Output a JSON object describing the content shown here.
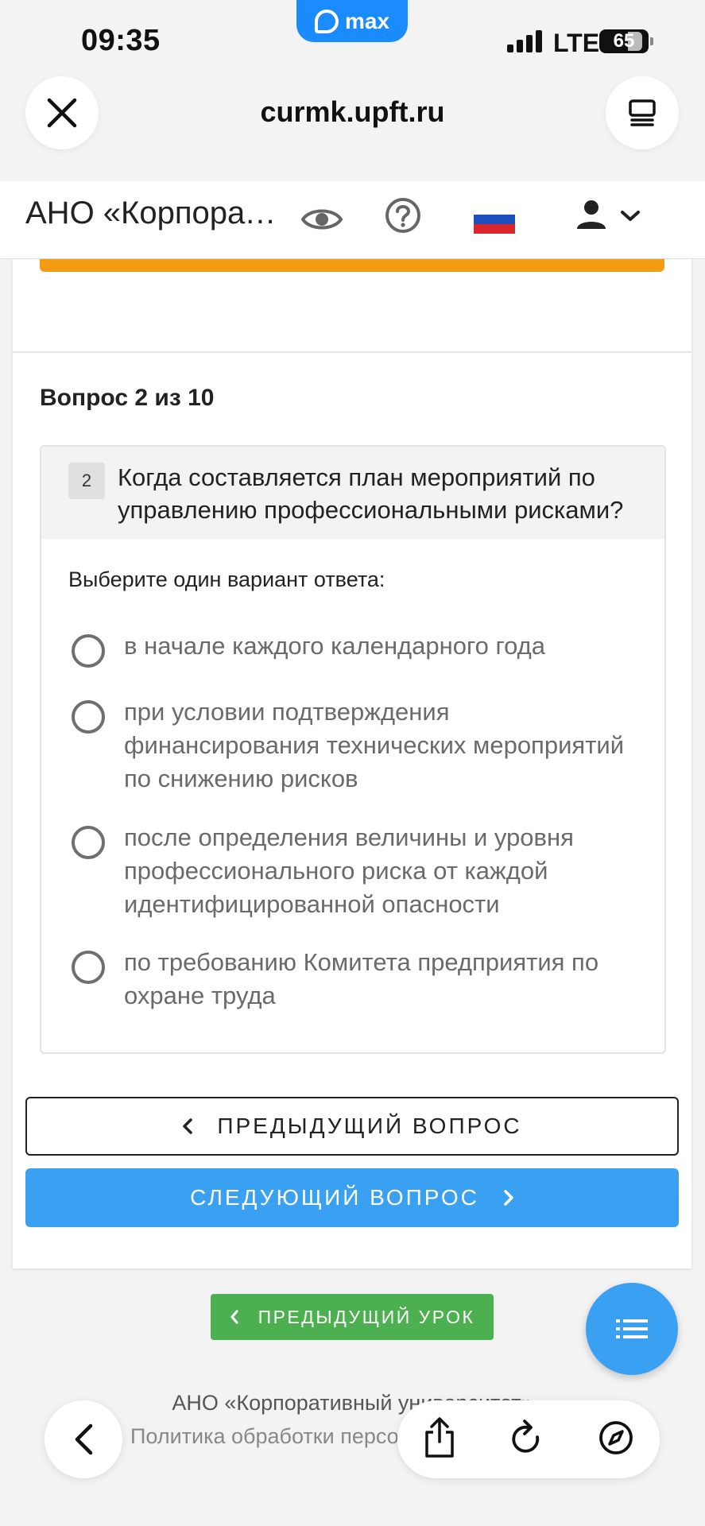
{
  "status_bar": {
    "time": "09:35",
    "app_badge": "max",
    "network": "LTE",
    "battery": "65"
  },
  "browser": {
    "url": "curmk.upft.ru",
    "icons": [
      "close-icon",
      "tabs-icon",
      "back-icon",
      "share-icon",
      "reload-icon",
      "compass-icon"
    ]
  },
  "site_header": {
    "title": "АНО «Корпоративный университет»",
    "icons": [
      "eye-icon",
      "help-icon",
      "russian-flag-icon",
      "user-icon",
      "chevron-down-icon"
    ],
    "flag_colors": [
      "#ffffff",
      "#1f4fbf",
      "#d9262c"
    ]
  },
  "quiz": {
    "counter": "Вопрос 2 из 10",
    "question_number": "2",
    "question_text": "Когда составляется план мероприятий по управлению профессиональными рисками?",
    "instruction": "Выберите один вариант ответа:",
    "options": [
      {
        "label": "в начале каждого календарного года",
        "selected": false
      },
      {
        "label": "при условии подтверждения финансирования технических мероприятий по снижению рисков",
        "selected": false
      },
      {
        "label": "после определения величины и уровня профессионального риска от каждой идентифицированной опасности",
        "selected": false
      },
      {
        "label": "по требованию Комитета предприятия по охране труда",
        "selected": false
      }
    ],
    "prev_button": "ПРЕДЫДУЩИЙ ВОПРОС",
    "next_button": "СЛЕДУЮЩИЙ ВОПРОС"
  },
  "navigation": {
    "prev_lesson_button": "ПРЕДЫДУЩИЙ УРОК"
  },
  "footer": {
    "org": "АНО «Корпоративный университет»",
    "policy": "Политика обработки персональных данных"
  },
  "colors": {
    "accent_blue": "#3aa0f2",
    "lesson_green": "#4caf50",
    "progress_orange": "#f39c12",
    "max_blue": "#1a8cff"
  }
}
